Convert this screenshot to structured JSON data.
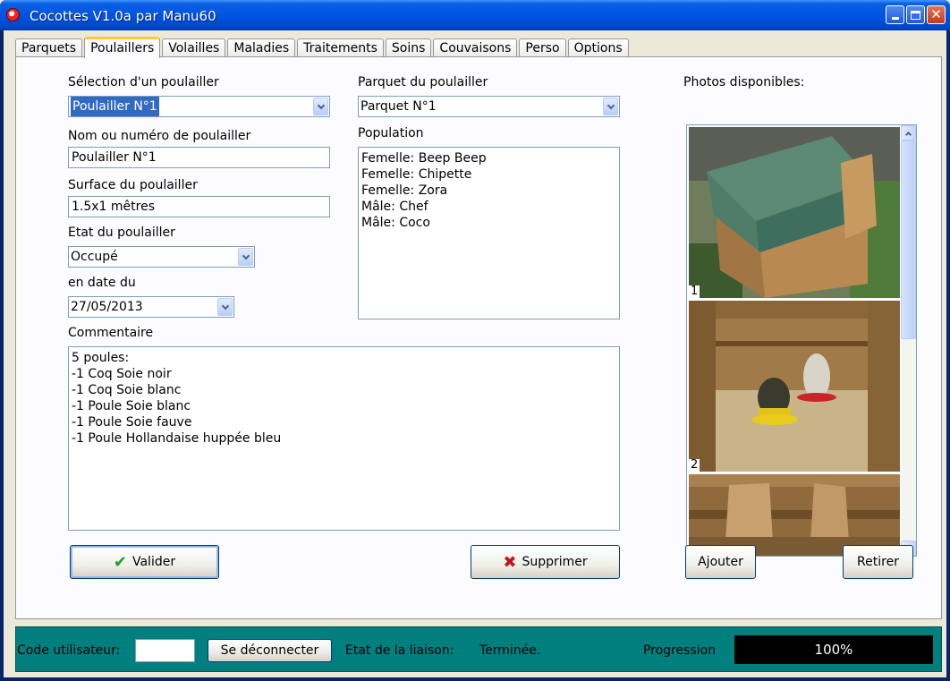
{
  "window": {
    "title": "Cocottes V1.0a par Manu60"
  },
  "tabs": [
    {
      "label": "Parquets",
      "active": false
    },
    {
      "label": "Poulaillers",
      "active": true
    },
    {
      "label": "Volailles",
      "active": false
    },
    {
      "label": "Maladies",
      "active": false
    },
    {
      "label": "Traitements",
      "active": false
    },
    {
      "label": "Soins",
      "active": false
    },
    {
      "label": "Couvaisons",
      "active": false
    },
    {
      "label": "Perso",
      "active": false
    },
    {
      "label": "Options",
      "active": false
    }
  ],
  "form": {
    "selection_label": "Sélection d'un poulailler",
    "selection_value": "Poulailler N°1",
    "name_label": "Nom ou numéro de poulailler",
    "name_value": "Poulailler N°1",
    "surface_label": "Surface du poulailler",
    "surface_value": "1.5x1 mêtres",
    "state_label": "Etat du poulailler",
    "state_value": "Occupé",
    "date_label": "en date du",
    "date_value": "27/05/2013",
    "parquet_label": "Parquet du poulailler",
    "parquet_value": "Parquet N°1",
    "population_label": "Population",
    "population": [
      "Femelle: Beep Beep",
      "Femelle: Chipette",
      "Femelle: Zora",
      "Mâle: Chef",
      "Mâle: Coco"
    ],
    "comment_label": "Commentaire",
    "comment_lines": [
      "5 poules:",
      "-1 Coq Soie noir",
      "-1 Coq Soie blanc",
      "-1 Poule Soie blanc",
      "-1 Poule Soie fauve",
      "-1 Poule Hollandaise huppée bleu"
    ]
  },
  "photos": {
    "label": "Photos disponibles:",
    "items": [
      {
        "number": "1"
      },
      {
        "number": "2"
      },
      {
        "number": ""
      }
    ]
  },
  "buttons": {
    "validate": "Valider",
    "delete": "Supprimer",
    "add": "Ajouter",
    "remove": "Retirer"
  },
  "status": {
    "user_code_label": "Code utilisateur:",
    "user_code_value": "",
    "disconnect_label": "Se déconnecter",
    "link_state_label": "Etat de la liaison:",
    "link_state_value": "Terminée.",
    "progress_label": "Progression",
    "progress_text": "100%",
    "progress_value": 1.0
  },
  "colors": {
    "titlebar": "#0054E3",
    "statusbar": "#007F7F",
    "selection": "#316AC5",
    "tab_highlight": "#FFC83C"
  }
}
